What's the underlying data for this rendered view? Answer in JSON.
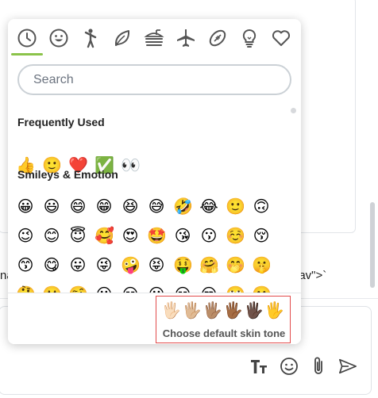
{
  "background": {
    "left_text": "na",
    "right_text": "nav\">`"
  },
  "picker": {
    "categories": [
      {
        "id": "recent",
        "icon": "clock-icon"
      },
      {
        "id": "smileys",
        "icon": "smiley-icon"
      },
      {
        "id": "people",
        "icon": "person-icon"
      },
      {
        "id": "nature",
        "icon": "leaf-icon"
      },
      {
        "id": "food",
        "icon": "food-icon"
      },
      {
        "id": "travel",
        "icon": "airplane-icon"
      },
      {
        "id": "activity",
        "icon": "football-icon"
      },
      {
        "id": "objects",
        "icon": "lightbulb-icon"
      },
      {
        "id": "symbols",
        "icon": "heart-icon"
      }
    ],
    "active_category": "recent",
    "accent_color": "#8bc34a",
    "search_placeholder": "Search",
    "sections": {
      "frequent": {
        "title": "Frequently Used",
        "emojis": [
          "👍",
          "🙂",
          "❤️",
          "✅",
          "👀"
        ]
      },
      "smileys": {
        "title": "Smileys & Emotion",
        "rows": [
          [
            "😀",
            "😃",
            "😄",
            "😁",
            "😆",
            "😅",
            "🤣",
            "😂",
            "🙂",
            "🙃"
          ],
          [
            "😉",
            "😊",
            "😇",
            "🥰",
            "😍",
            "🤩",
            "😘",
            "😗",
            "☺️",
            "😚"
          ],
          [
            "😙",
            "😋",
            "😛",
            "😜",
            "🤪",
            "😝",
            "🤑",
            "🤗",
            "🤭",
            "🤫"
          ],
          [
            "🤔",
            "🤐",
            "🤨",
            "😐",
            "😑",
            "😶",
            "😏",
            "😒",
            "🙄",
            "😬"
          ]
        ]
      }
    },
    "skin_tones": [
      "🖐🏻",
      "🖐🏼",
      "🖐🏽",
      "🖐🏾",
      "🖐🏿",
      "🖐️"
    ],
    "skin_tone_label": "Choose default skin tone",
    "highlight_color": "#e24b4b"
  },
  "compose_tools": [
    {
      "name": "format-text-icon",
      "glyph": "Tт"
    },
    {
      "name": "emoji-icon",
      "glyph": ""
    },
    {
      "name": "attachment-icon",
      "glyph": ""
    },
    {
      "name": "send-icon",
      "glyph": ""
    }
  ]
}
